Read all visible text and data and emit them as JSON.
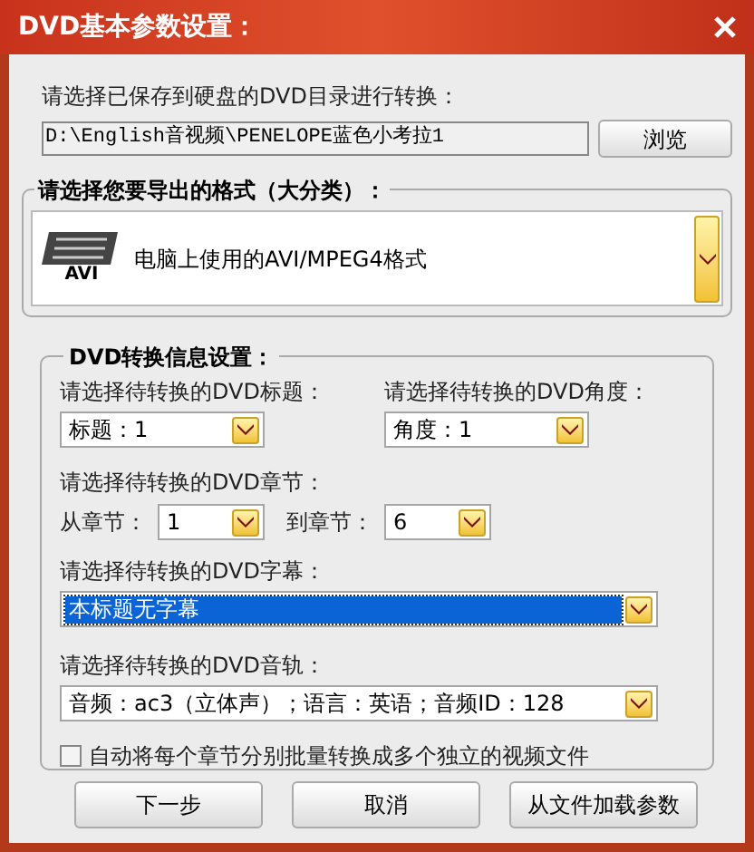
{
  "window": {
    "title": "DVD基本参数设置："
  },
  "source": {
    "label": "请选择已保存到硬盘的DVD目录进行转换：",
    "path": "D:\\English音视频\\PENELOPE蓝色小考拉1",
    "browse": "浏览"
  },
  "format_group": {
    "legend": "请选择您要导出的格式（大分类）：",
    "logo_caption": "AVI",
    "format": "电脑上使用的AVI/MPEG4格式"
  },
  "dvd_group": {
    "legend": "DVD转换信息设置：",
    "title_label": "请选择待转换的DVD标题：",
    "title_value": "标题：1",
    "angle_label": "请选择待转换的DVD角度：",
    "angle_value": "角度：1",
    "chapter_label": "请选择待转换的DVD章节：",
    "from_label": "从章节：",
    "from_value": "1",
    "to_label": "到章节：",
    "to_value": "6",
    "subtitle_label": "请选择待转换的DVD字幕：",
    "subtitle_value": "本标题无字幕",
    "subtitle_focused": true,
    "audio_label": "请选择待转换的DVD音轨：",
    "audio_value": "音频：ac3（立体声）；语言：英语；音频ID：128",
    "split": {
      "label": "自动将每个章节分别批量转换成多个独立的视频文件",
      "checked": false
    }
  },
  "buttons": [
    "下一步",
    "取消",
    "从文件加载参数"
  ]
}
